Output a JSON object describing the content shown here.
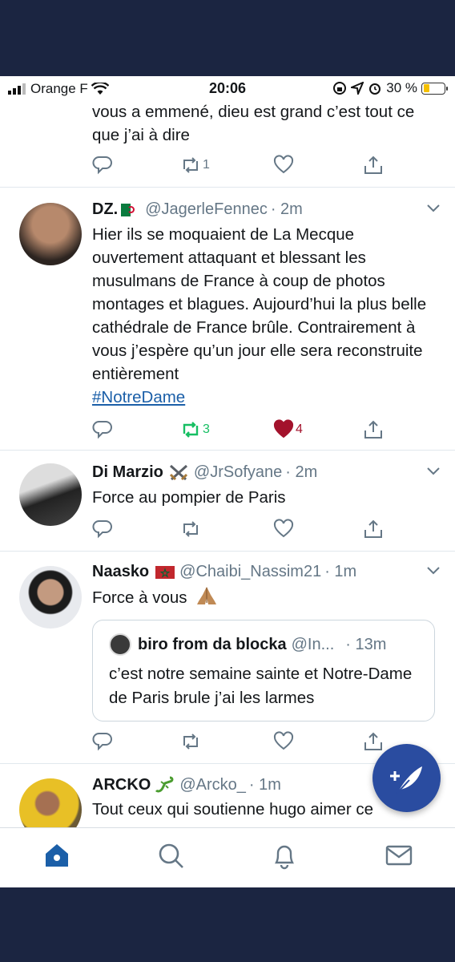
{
  "status_bar": {
    "carrier": "Orange F",
    "time": "20:06",
    "battery": "30 %"
  },
  "tweets": [
    {
      "text_tail": "vous a emmené, dieu est grand c’est tout ce que j’ai à dire",
      "retweets": "1",
      "likes": ""
    },
    {
      "name": "DZ.",
      "handle": "@JagerleFennec",
      "time": "· 2m",
      "text": "Hier ils se moquaient de La Mecque ouvertement attaquant et blessant les musulmans de France à coup de photos montages et blagues. Aujourd’hui la plus belle cathédrale de France brûle. Contrairement à vous j’espère qu’un jour elle sera reconstruite entièrement",
      "hashtag": "#NotreDame",
      "retweets": "3",
      "likes": "4"
    },
    {
      "name": "Di Marzio",
      "handle": "@JrSofyane",
      "time": "· 2m",
      "text": "Force au pompier de Paris",
      "retweets": "",
      "likes": ""
    },
    {
      "name": "Naasko",
      "handle": "@Chaibi_Nassim21",
      "time": "· 1m",
      "text": "Force à vous",
      "quote": {
        "name": "biro from da blocka",
        "handle": "@In...",
        "time": "· 13m",
        "text": "c’est notre semaine sainte et Notre-Dame de Paris brule j’ai les larmes"
      },
      "retweets": "",
      "likes": ""
    },
    {
      "name": "ARCKO",
      "handle": "@Arcko_",
      "time": "· 1m",
      "text": "Tout ceux qui soutienne hugo aimer ce"
    }
  ],
  "colors": {
    "accent": "#1b5fa8",
    "retweet_active": "#17bf63",
    "like_active": "#a3122c",
    "fab": "#2a4ca0",
    "frame": "#1b2541"
  },
  "tabs": [
    "home-icon",
    "search-icon",
    "notifications-icon",
    "messages-icon"
  ]
}
